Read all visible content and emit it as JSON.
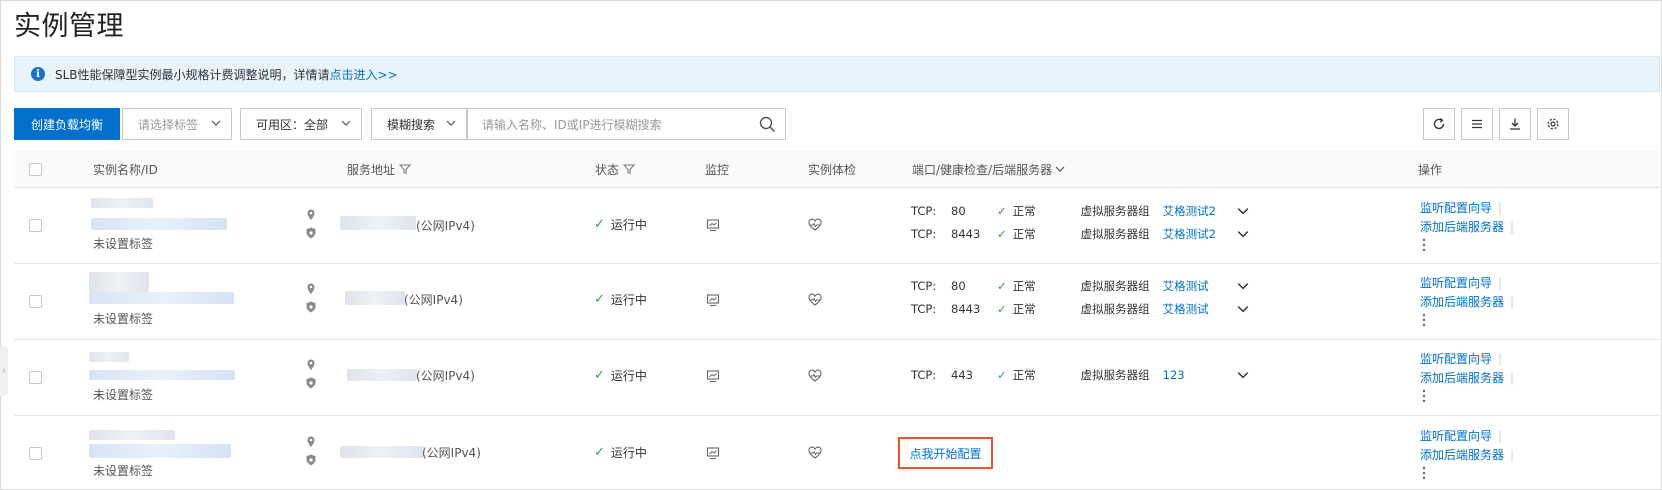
{
  "page": {
    "title": "实例管理"
  },
  "notice": {
    "text": "SLB性能保障型实例最小规格计费调整说明，详情请",
    "link": "点击进入>>"
  },
  "toolbar": {
    "create_button": "创建负载均衡",
    "tag_select_placeholder": "请选择标签",
    "zone_select": "可用区：全部",
    "search_type": "模糊搜索",
    "search_placeholder": "请输入名称、ID或IP进行模糊搜索",
    "icons": [
      "refresh-icon",
      "list-icon",
      "download-icon",
      "settings-icon"
    ]
  },
  "table": {
    "headers": {
      "name": "实例名称/ID",
      "address": "服务地址",
      "status": "状态",
      "monitor": "监控",
      "health": "实例体检",
      "ports": "端口/健康检查/后端服务器",
      "actions": "操作"
    },
    "rows": [
      {
        "tag": "未设置标签",
        "address_suffix": "(公网IPv4)",
        "status": "运行中",
        "listeners": [
          {
            "proto": "TCP:",
            "port": "80",
            "health": "正常",
            "group_type": "虚拟服务器组",
            "group": "艾格测试2"
          },
          {
            "proto": "TCP:",
            "port": "8443",
            "health": "正常",
            "group_type": "虚拟服务器组",
            "group": "艾格测试2"
          }
        ],
        "actions": [
          "监听配置向导",
          "添加后端服务器"
        ]
      },
      {
        "tag": "未设置标签",
        "address_suffix": "(公网IPv4)",
        "status": "运行中",
        "listeners": [
          {
            "proto": "TCP:",
            "port": "80",
            "health": "正常",
            "group_type": "虚拟服务器组",
            "group": "艾格测试"
          },
          {
            "proto": "TCP:",
            "port": "8443",
            "health": "正常",
            "group_type": "虚拟服务器组",
            "group": "艾格测试"
          }
        ],
        "actions": [
          "监听配置向导",
          "添加后端服务器"
        ]
      },
      {
        "tag": "未设置标签",
        "address_suffix": "(公网IPv4)",
        "status": "运行中",
        "listeners": [
          {
            "proto": "TCP:",
            "port": "443",
            "health": "正常",
            "group_type": "虚拟服务器组",
            "group": "123"
          }
        ],
        "actions": [
          "监听配置向导",
          "添加后端服务器"
        ]
      },
      {
        "tag": "未设置标签",
        "address_suffix": "(公网IPv4)",
        "status": "运行中",
        "config_button": "点我开始配置",
        "actions": [
          "监听配置向导",
          "添加后端服务器"
        ]
      }
    ]
  },
  "colors": {
    "primary": "#0070cc",
    "success": "#2f9e44",
    "highlight": "#e8542f",
    "notice_bg": "#e8f3fc"
  }
}
